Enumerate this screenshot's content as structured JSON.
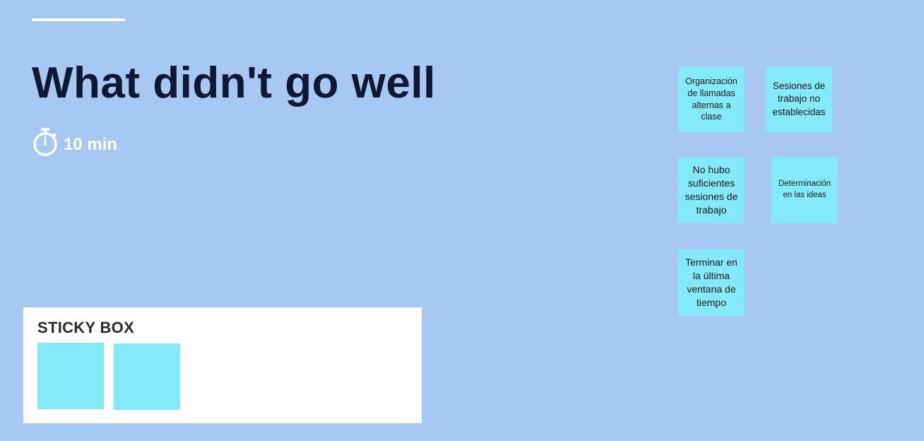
{
  "frame": {
    "title": "What didn't go well",
    "timer": {
      "icon": "stopwatch-icon",
      "label": "10 min"
    }
  },
  "stickies": [
    {
      "text": "Organización de llamadas alternas a clase"
    },
    {
      "text": "Sesiones de trabajo no establecidas"
    },
    {
      "text": "No hubo suficientes sesiones de trabajo"
    },
    {
      "text": "Determinación en las ideas"
    },
    {
      "text": "Terminar en la última ventana de tiempo"
    }
  ],
  "sticky_box": {
    "title": "STICKY BOX",
    "empty_stickies": 2
  },
  "colors": {
    "background": "#a7c8f2",
    "sticky": "#84e9f9",
    "title": "#0f1733",
    "accent": "#ffffff"
  }
}
